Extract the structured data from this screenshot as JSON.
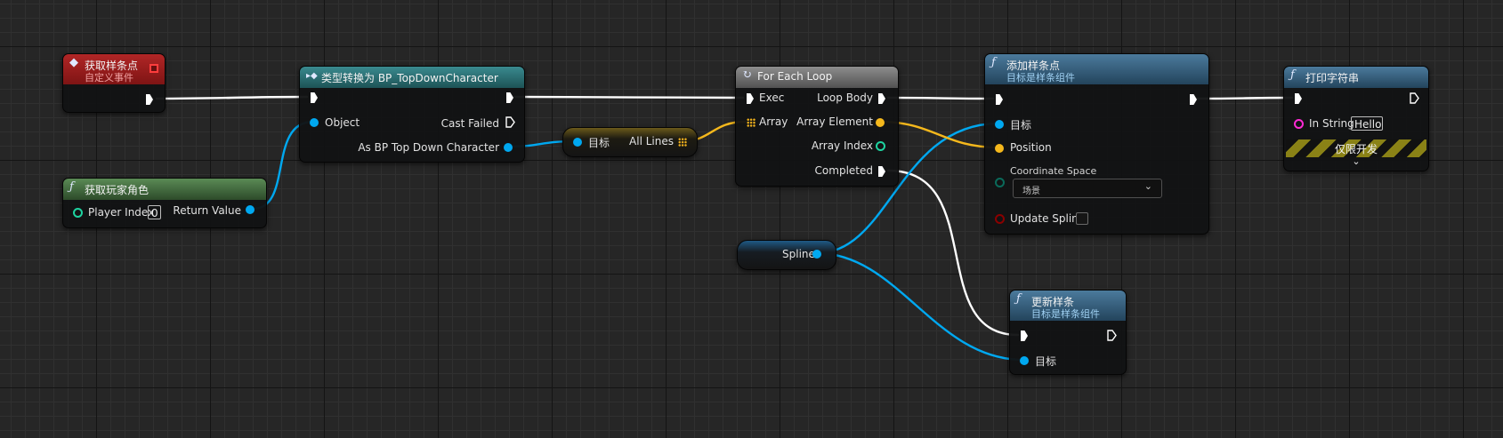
{
  "nodes": {
    "get_spline_points": {
      "title": "获取样条点",
      "subtitle": "自定义事件"
    },
    "cast": {
      "title": "类型转换为 BP_TopDownCharacter",
      "pin_object": "Object",
      "pin_cast_failed": "Cast Failed",
      "pin_as_character": "As BP Top Down Character"
    },
    "get_player": {
      "title": "获取玩家角色",
      "pin_player_index": "Player Index",
      "player_index_value": "0",
      "pin_return_value": "Return Value"
    },
    "all_lines": {
      "pin_target": "目标",
      "pin_all_lines": "All Lines"
    },
    "for_each": {
      "title": "For Each Loop",
      "pin_exec": "Exec",
      "pin_loop_body": "Loop Body",
      "pin_array": "Array",
      "pin_array_element": "Array Element",
      "pin_array_index": "Array Index",
      "pin_completed": "Completed"
    },
    "add_spline_point": {
      "title": "添加样条点",
      "subtitle": "目标是样条组件",
      "pin_target": "目标",
      "pin_position": "Position",
      "pin_coord_space": "Coordinate Space",
      "coord_space_value": "场景",
      "pin_update_spline": "Update Spline"
    },
    "print_string": {
      "title": "打印字符串",
      "pin_in_string": "In String",
      "in_string_value": "Hello",
      "dev_only": "仅限开发"
    },
    "spline_var": {
      "label": "Spline"
    },
    "update_spline": {
      "title": "更新样条",
      "subtitle": "目标是样条组件",
      "pin_target": "目标"
    }
  },
  "colors": {
    "exec": "#ffffff",
    "object": "#00a8f0",
    "vector": "#f5b81c",
    "integer": "#1ed3a0",
    "string": "#ff2ad4",
    "bool": "#a00000"
  }
}
